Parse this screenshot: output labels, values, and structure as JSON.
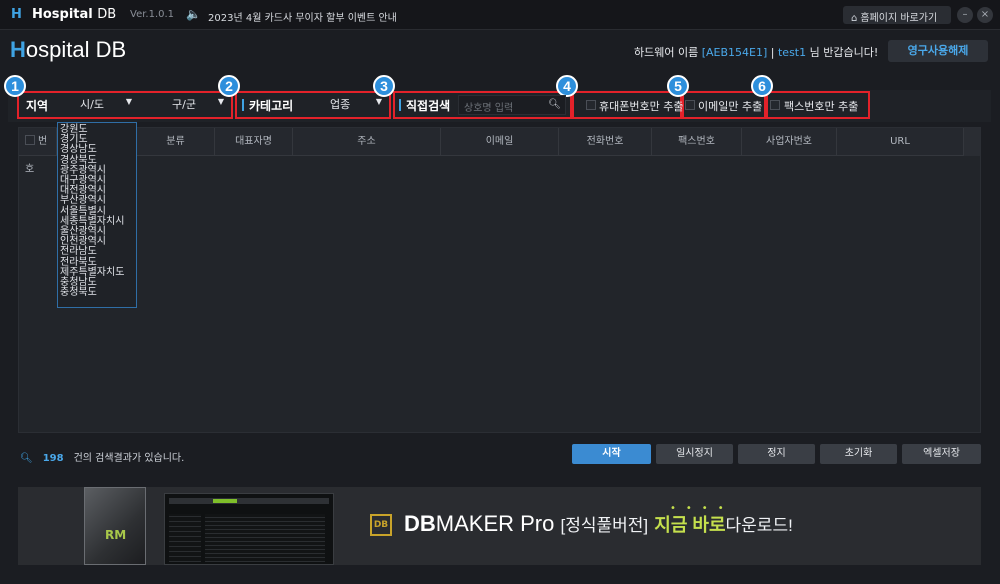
{
  "titlebar": {
    "logo_letter": "H",
    "app_name_bold": "Hospital",
    "app_name_rest": "DB",
    "version": "Ver.1.0.1",
    "notice": "2023년 4월 카드사 무이자 할부 이벤트 안내",
    "home_button": "홈페이지 바로가기",
    "minimize": "–",
    "close": "×"
  },
  "header": {
    "logo_first": "H",
    "logo_rest": "ospital",
    "logo_db": "DB",
    "greet_prefix": "하드웨어 이름 ",
    "hardware_id": "[AEB154E1]",
    "sep": " | ",
    "user_id": "test1",
    "greet_suffix": " 님 반갑습니다!",
    "perm_button": "영구사용해제"
  },
  "filters": {
    "badges": [
      "1",
      "2",
      "3",
      "4",
      "5",
      "6"
    ],
    "region_label": "지역",
    "sido_value": "시/도",
    "gugun_value": "구/군",
    "category_label": "카테고리",
    "category_value": "업종",
    "search_label": "직접검색",
    "search_placeholder": "상호명 입력",
    "only_mobile": "휴대폰번호만 추출",
    "only_email": "이메일만 추출",
    "only_fax": "팩스번호만 추출"
  },
  "table": {
    "columns": [
      "번호",
      "분류",
      "대표자명",
      "주소",
      "이메일",
      "전화번호",
      "팩스번호",
      "사업자번호",
      "URL"
    ]
  },
  "dropdown_items": [
    "강원도",
    "경기도",
    "경상남도",
    "경상북도",
    "광주광역시",
    "대구광역시",
    "대전광역시",
    "부산광역시",
    "서울특별시",
    "세종특별자치시",
    "울산광역시",
    "인천광역시",
    "전라남도",
    "전라북도",
    "제주특별자치도",
    "충청남도",
    "충청북도"
  ],
  "status": {
    "count": "198",
    "message": "건의 검색결과가 있습니다."
  },
  "actions": {
    "start": "시작",
    "pause": "일시정지",
    "stop": "정지",
    "reset": "초기화",
    "excel": "엑셀저장"
  },
  "banner": {
    "icon_text": "DB",
    "box_mark": "RM",
    "product_bold": "DB",
    "product_rest": "MAKER Pro",
    "edition": "[정식풀버전]",
    "now": "지금 바로",
    "download": "다운로드!"
  },
  "colors": {
    "accent": "#3fa3e3",
    "highlight_box": "#e3222a",
    "badge": "#2d8fdc",
    "primary_button": "#3b8bd2",
    "banner_green": "#c5e04d"
  }
}
